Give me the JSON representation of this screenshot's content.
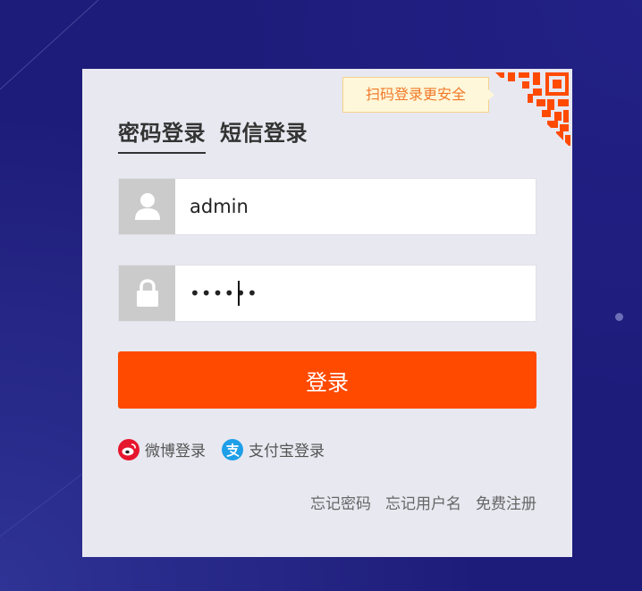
{
  "tabs": {
    "password_login": "密码登录",
    "sms_login": "短信登录"
  },
  "qr": {
    "tip": "扫码登录更安全"
  },
  "form": {
    "username_value": "admin",
    "password_value": "••••••"
  },
  "login_button": "登录",
  "social": {
    "weibo": "微博登录",
    "alipay": "支付宝登录"
  },
  "links": {
    "forgot_password": "忘记密码",
    "forgot_username": "忘记用户名",
    "register": "免费注册"
  },
  "colors": {
    "accent": "#ff4a00",
    "background": "#1e1c7a",
    "panel": "#e8e8f1"
  }
}
